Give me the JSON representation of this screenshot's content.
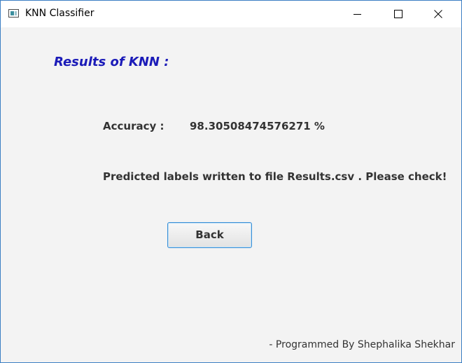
{
  "window": {
    "title": "KNN Classifier",
    "icon": "java-app-icon",
    "controls": {
      "minimize_icon": "minimize-icon",
      "maximize_icon": "maximize-icon",
      "close_icon": "close-icon"
    }
  },
  "main": {
    "heading": "Results of KNN :",
    "accuracy_label": "Accuracy :",
    "accuracy_value": "98.30508474576271 %",
    "predicted_message": "Predicted labels written to file Results.csv . Please check!",
    "back_button_label": "Back",
    "footer_credit": "- Programmed By Shephalika Shekhar"
  },
  "colors": {
    "heading": "#1b1bb8",
    "text": "#333333",
    "background": "#f3f3f3",
    "window_border": "#3c7fc4",
    "button_border": "#3a8fd6"
  }
}
